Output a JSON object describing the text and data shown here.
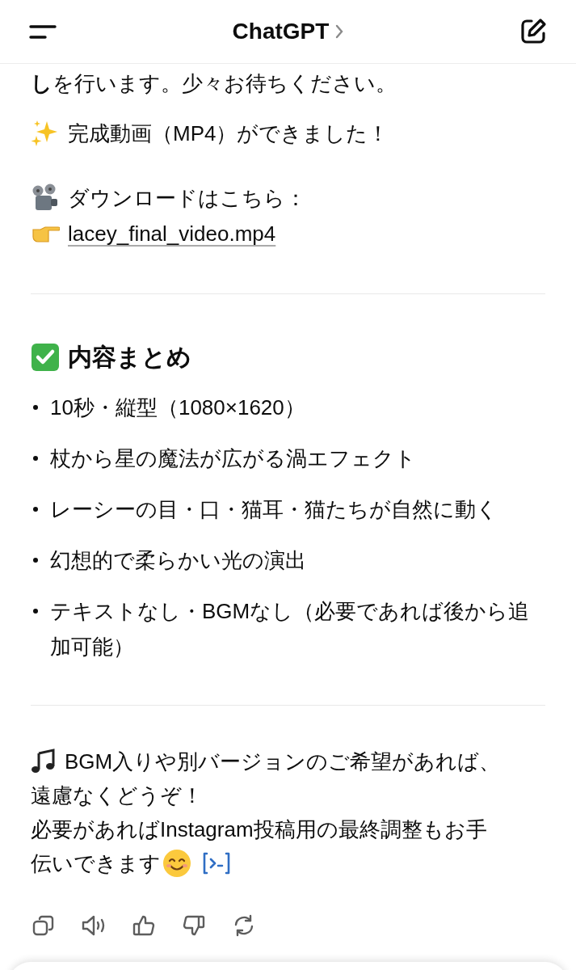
{
  "header": {
    "title": "ChatGPT"
  },
  "message": {
    "intro": "**し**を行います。少々お待ちください。",
    "done": "完成動画（MP4）ができました！",
    "download_label": "ダウンロードはこちら：",
    "download_link": "lacey_final_video.mp4",
    "summary_heading": "内容まとめ",
    "summary_items": [
      "10秒・縦型（1080×1620）",
      "杖から星の魔法が広がる渦エフェクト",
      "レーシーの目・口・猫耳・猫たちが自然に動く",
      "幻想的で柔らかい光の演出",
      "テキストなし・BGMなし（必要であれば後から追加可能）"
    ],
    "closing_lines": [
      "BGM入りや別バージョンのご希望があれば、",
      "遠慮なくどうぞ！",
      "必要があればInstagram投稿用の最終調整もお手",
      "伝いできます"
    ]
  }
}
